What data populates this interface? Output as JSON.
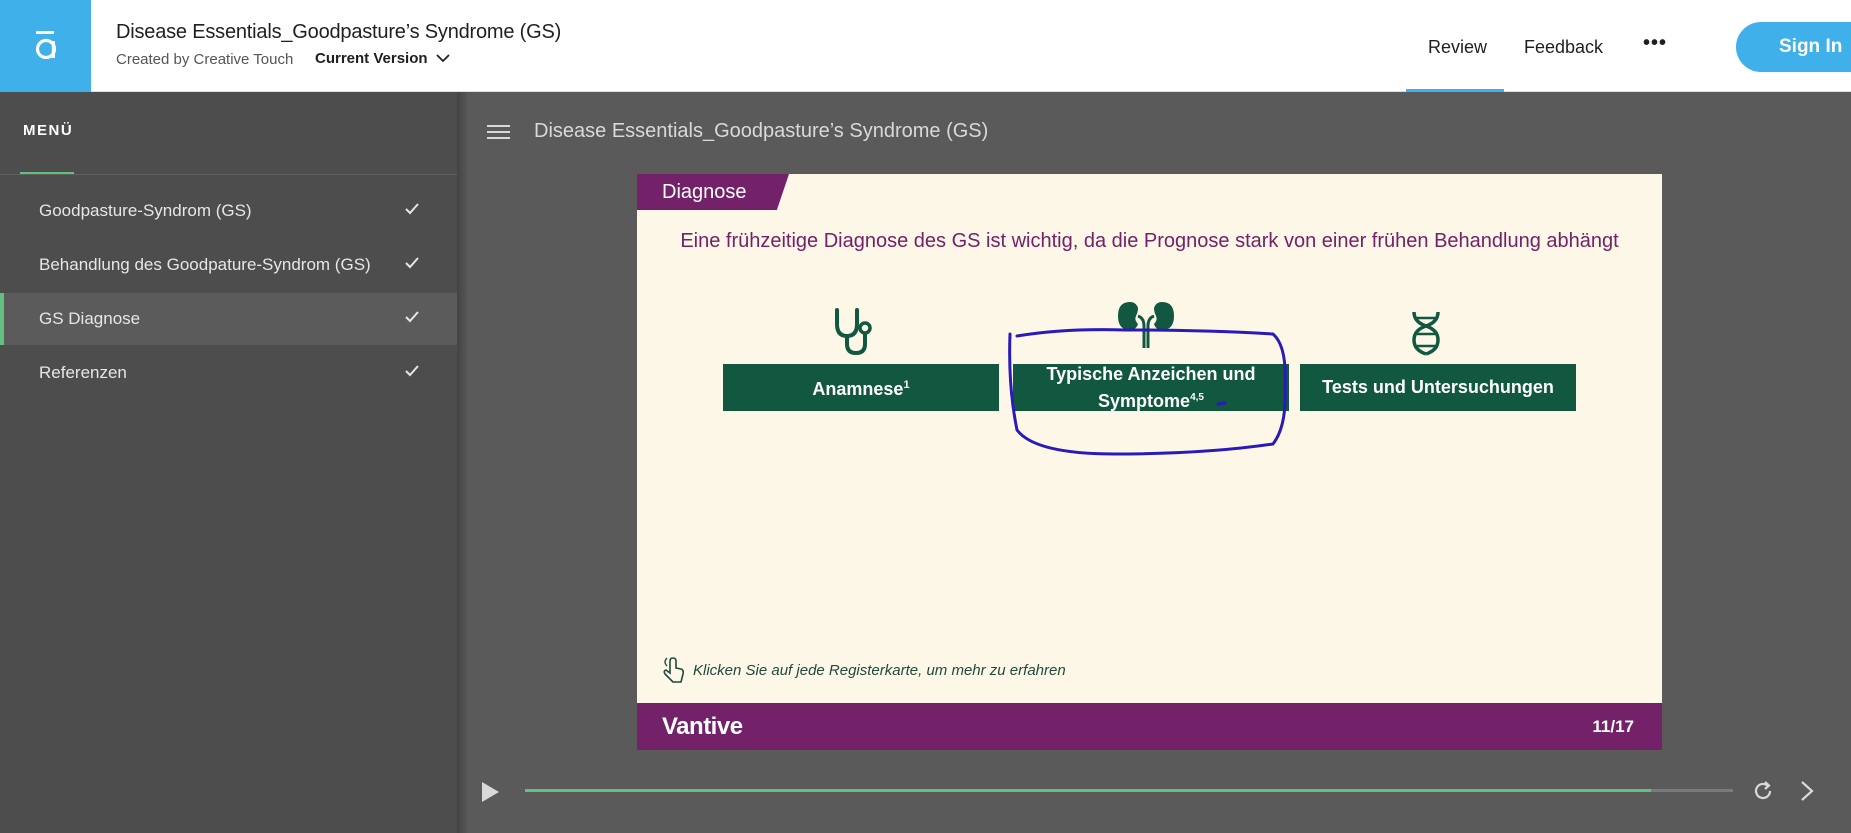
{
  "header": {
    "logo_icon": "articulate-a-icon",
    "title": "Disease Essentials_Goodpasture’s Syndrome (GS)",
    "created_by": "Created by Creative Touch",
    "version_label": "Current Version",
    "nav": {
      "review": "Review",
      "feedback": "Feedback",
      "more": "•••"
    },
    "sign_in": "Sign In"
  },
  "sidebar": {
    "title": "MENÜ",
    "items": [
      {
        "label": "Goodpasture-Syndrom (GS)",
        "completed": true
      },
      {
        "label": "Behandlung des Goodpature-Syndrom (GS)",
        "completed": true
      },
      {
        "label": "GS Diagnose",
        "completed": true,
        "active": true
      },
      {
        "label": "Referenzen",
        "completed": true
      }
    ]
  },
  "main": {
    "course_title": "Disease Essentials_Goodpasture’s Syndrome (GS)"
  },
  "slide": {
    "tab": "Diagnose",
    "heading": "Eine frühzeitige Diagnose des GS ist wichtig, da die Prognose stark von einer frühen Behandlung abhängt",
    "cards": [
      {
        "icon": "stethoscope-icon",
        "label": "Anamnese",
        "sup": "1"
      },
      {
        "icon": "kidney-icon",
        "label_line1": "Typische Anzeichen und",
        "label_line2": "Symptome",
        "sup": "4,5"
      },
      {
        "icon": "dna-icon",
        "label": "Tests und Untersuchungen"
      }
    ],
    "hint": "Klicken Sie auf jede Registerkarte, um mehr zu erfahren",
    "brand": "Vantive",
    "page_indicator": "11/17"
  },
  "player": {
    "progress": 0.932
  },
  "colors": {
    "accent_blue": "#3fb0ea",
    "accent_green": "#62c17e",
    "slide_purple": "#732168",
    "card_green": "#12573f",
    "annotation_blue": "#2a1ab8"
  }
}
